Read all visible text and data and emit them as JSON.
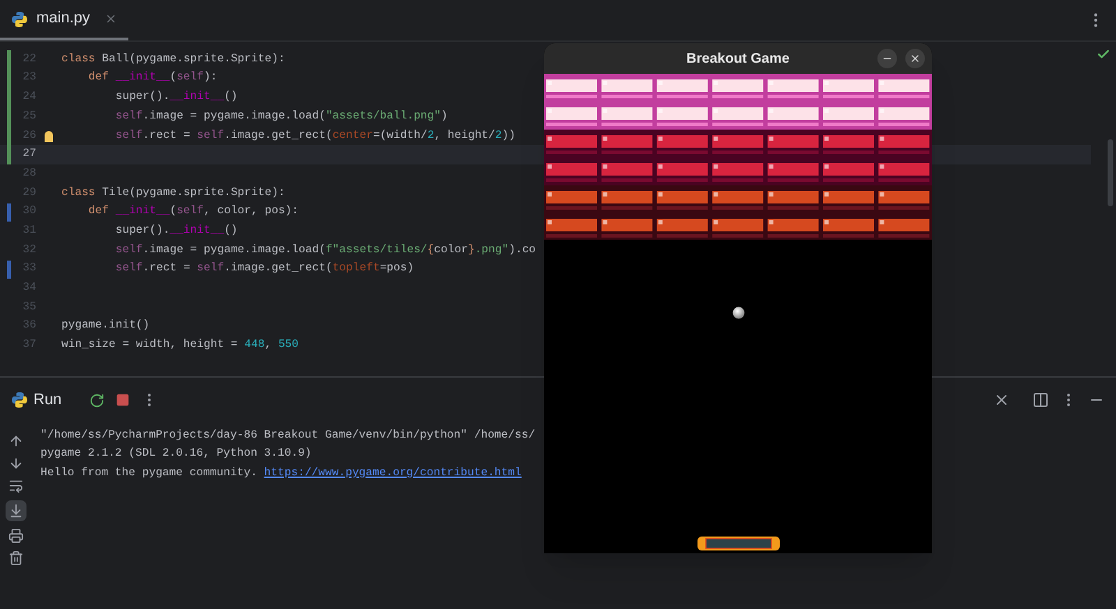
{
  "editor_tabs": [
    {
      "label": "main.py",
      "selected": true
    }
  ],
  "editor": {
    "lines": [
      {
        "number": "22",
        "added": true,
        "modified": false,
        "current": false,
        "hint": false,
        "tokens": [
          {
            "kind": "keyword",
            "text": "class "
          },
          {
            "kind": "plain",
            "text": "Ball(pygame.sprite.Sprite):"
          }
        ]
      },
      {
        "number": "23",
        "added": true,
        "modified": false,
        "current": false,
        "hint": false,
        "tokens": [
          {
            "kind": "keyword",
            "text": "    def "
          },
          {
            "kind": "dunder",
            "text": "__init__"
          },
          {
            "kind": "plain",
            "text": "("
          },
          {
            "kind": "self",
            "text": "self"
          },
          {
            "kind": "plain",
            "text": "):"
          }
        ]
      },
      {
        "number": "24",
        "added": true,
        "modified": false,
        "current": false,
        "hint": false,
        "tokens": [
          {
            "kind": "plain",
            "text": "        super()."
          },
          {
            "kind": "dunder",
            "text": "__init__"
          },
          {
            "kind": "plain",
            "text": "()"
          }
        ]
      },
      {
        "number": "25",
        "added": true,
        "modified": false,
        "current": false,
        "hint": false,
        "tokens": [
          {
            "kind": "self",
            "text": "        self"
          },
          {
            "kind": "plain",
            "text": ".image = pygame.image.load("
          },
          {
            "kind": "string",
            "text": "\"assets/ball.png\""
          },
          {
            "kind": "plain",
            "text": ")"
          }
        ]
      },
      {
        "number": "26",
        "added": true,
        "modified": false,
        "current": false,
        "hint": true,
        "tokens": [
          {
            "kind": "self",
            "text": "        self"
          },
          {
            "kind": "plain",
            "text": ".rect = "
          },
          {
            "kind": "self",
            "text": "self"
          },
          {
            "kind": "plain",
            "text": ".image.get_rect("
          },
          {
            "kind": "argument",
            "text": "center"
          },
          {
            "kind": "plain",
            "text": "=(width/"
          },
          {
            "kind": "number",
            "text": "2"
          },
          {
            "kind": "plain",
            "text": ", height/"
          },
          {
            "kind": "number",
            "text": "2"
          },
          {
            "kind": "plain",
            "text": "))"
          }
        ]
      },
      {
        "number": "27",
        "added": true,
        "modified": false,
        "current": true,
        "hint": false
      },
      {
        "number": "28",
        "added": false,
        "modified": false,
        "current": false,
        "hint": false
      },
      {
        "number": "29",
        "added": false,
        "modified": false,
        "current": false,
        "hint": false,
        "tokens": [
          {
            "kind": "keyword",
            "text": "class "
          },
          {
            "kind": "plain",
            "text": "Tile(pygame.sprite.Sprite):"
          }
        ]
      },
      {
        "number": "30",
        "added": false,
        "modified": true,
        "current": false,
        "hint": false,
        "tokens": [
          {
            "kind": "keyword",
            "text": "    def "
          },
          {
            "kind": "dunder",
            "text": "__init__"
          },
          {
            "kind": "plain",
            "text": "("
          },
          {
            "kind": "self",
            "text": "self"
          },
          {
            "kind": "plain",
            "text": ", color, pos):"
          }
        ]
      },
      {
        "number": "31",
        "added": false,
        "modified": false,
        "current": false,
        "hint": false,
        "tokens": [
          {
            "kind": "plain",
            "text": "        super()."
          },
          {
            "kind": "dunder",
            "text": "__init__"
          },
          {
            "kind": "plain",
            "text": "()"
          }
        ]
      },
      {
        "number": "32",
        "added": false,
        "modified": false,
        "current": false,
        "hint": false,
        "tokens": [
          {
            "kind": "self",
            "text": "        self"
          },
          {
            "kind": "plain",
            "text": ".image = pygame.image.load("
          },
          {
            "kind": "string",
            "text": "f\"assets/tiles/"
          },
          {
            "kind": "keyword",
            "text": "{"
          },
          {
            "kind": "plain",
            "text": "color"
          },
          {
            "kind": "keyword",
            "text": "}"
          },
          {
            "kind": "string",
            "text": ".png\""
          },
          {
            "kind": "plain",
            "text": ").co"
          }
        ]
      },
      {
        "number": "33",
        "added": false,
        "modified": true,
        "current": false,
        "hint": false,
        "tokens": [
          {
            "kind": "self",
            "text": "        self"
          },
          {
            "kind": "plain",
            "text": ".rect = "
          },
          {
            "kind": "self",
            "text": "self"
          },
          {
            "kind": "plain",
            "text": ".image.get_rect("
          },
          {
            "kind": "argument",
            "text": "topleft"
          },
          {
            "kind": "plain",
            "text": "=pos)"
          }
        ]
      },
      {
        "number": "34",
        "added": false,
        "modified": false,
        "current": false,
        "hint": false
      },
      {
        "number": "35",
        "added": false,
        "modified": false,
        "current": false,
        "hint": false
      },
      {
        "number": "36",
        "added": false,
        "modified": false,
        "current": false,
        "hint": false,
        "tokens": [
          {
            "kind": "plain",
            "text": "pygame.init()"
          }
        ]
      },
      {
        "number": "37",
        "added": false,
        "modified": false,
        "current": false,
        "hint": false,
        "tokens": [
          {
            "kind": "plain",
            "text": "win_size = width, height = "
          },
          {
            "kind": "number",
            "text": "448"
          },
          {
            "kind": "plain",
            "text": ", "
          },
          {
            "kind": "number",
            "text": "550"
          }
        ]
      }
    ]
  },
  "run_panel": {
    "tab": "Run",
    "console": [
      {
        "text": "\"/home/ss/PycharmProjects/day-86 Breakout Game/venv/bin/python\" /home/ss/"
      },
      {
        "text": "pygame 2.1.2 (SDL 2.0.16, Python 3.10.9)"
      },
      {
        "text": "Hello from the pygame community. ",
        "link": "https://www.pygame.org/contribute.html"
      }
    ]
  },
  "game_window": {
    "title": "Breakout Game"
  }
}
